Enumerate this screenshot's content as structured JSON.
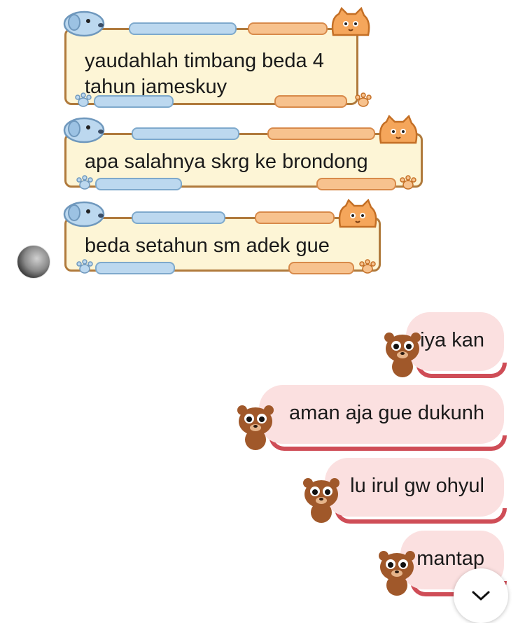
{
  "incoming": [
    {
      "text_lines": [
        "yaudahlah timbang beda 4",
        "tahun jameskuy"
      ]
    },
    {
      "text_lines": [
        "apa salahnya skrg ke brondong"
      ]
    },
    {
      "text_lines": [
        "beda setahun sm adek gue"
      ]
    }
  ],
  "outgoing": [
    {
      "text": "iya kan"
    },
    {
      "text": "aman aja gue dukunh"
    },
    {
      "text": "lu irul gw ohyul"
    },
    {
      "text": "mantap"
    }
  ],
  "icons": {
    "avatar": "contact-avatar",
    "scroll_down": "chevron-down-icon",
    "sticker_left": "blue-dog-icon",
    "sticker_right": "orange-cat-icon",
    "bubble_bear": "brown-bear-icon"
  },
  "colors": {
    "incoming_bubble": "#fdf5d6",
    "incoming_border": "#b07a3c",
    "outgoing_bubble": "#fbe0e0",
    "outgoing_rim": "#cf4d57"
  }
}
